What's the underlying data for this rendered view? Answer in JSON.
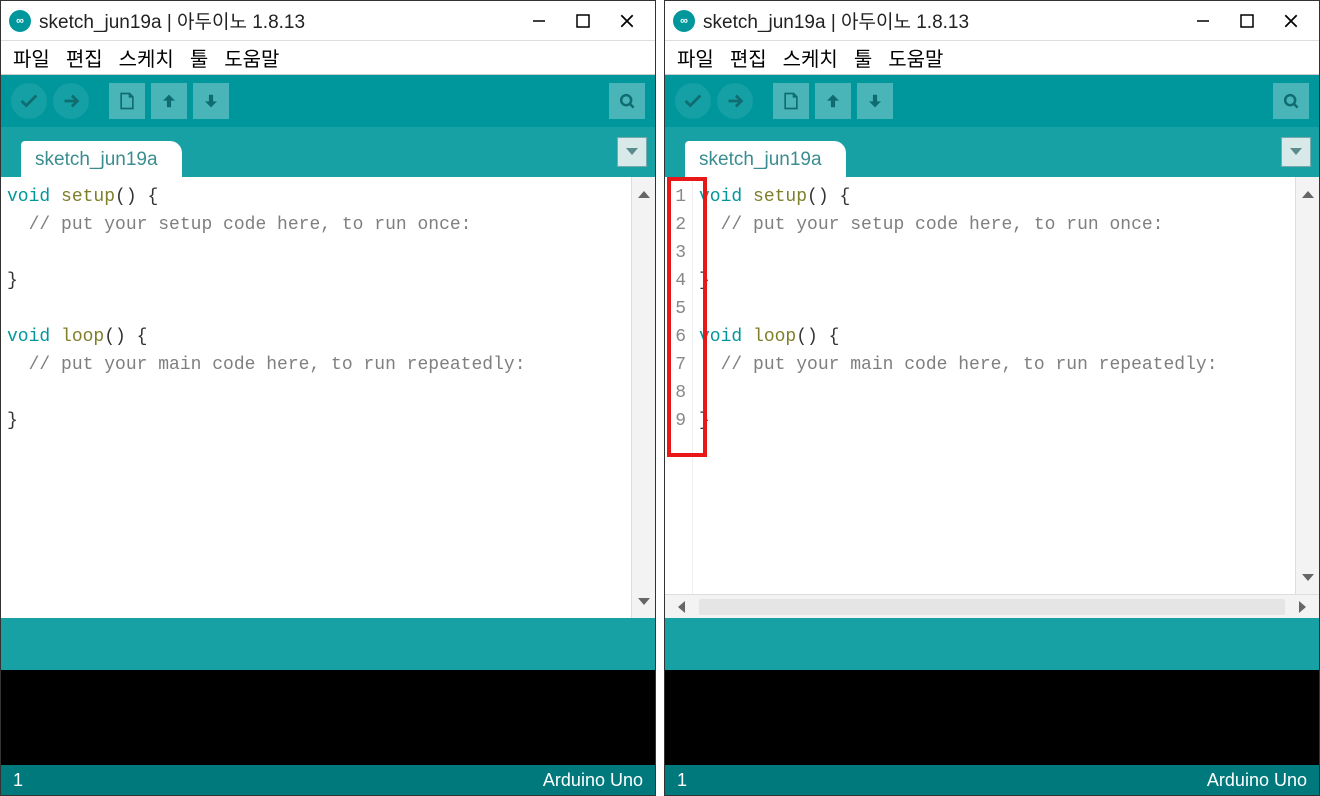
{
  "window": {
    "title": "sketch_jun19a | 아두이노 1.8.13",
    "iconGlyph": "∞"
  },
  "menu": {
    "file": "파일",
    "edit": "편집",
    "sketch": "스케치",
    "tools": "툴",
    "help": "도움말"
  },
  "tab": {
    "name": "sketch_jun19a"
  },
  "code": {
    "lines": [
      {
        "tokens": [
          {
            "t": "kw",
            "s": "void"
          },
          {
            "t": "p",
            "s": " "
          },
          {
            "t": "fn",
            "s": "setup"
          },
          {
            "t": "p",
            "s": "() {"
          }
        ]
      },
      {
        "tokens": [
          {
            "t": "p",
            "s": "  "
          },
          {
            "t": "cm",
            "s": "// put your setup code here, to run once:"
          }
        ]
      },
      {
        "tokens": [
          {
            "t": "p",
            "s": ""
          }
        ]
      },
      {
        "tokens": [
          {
            "t": "p",
            "s": "}"
          }
        ]
      },
      {
        "tokens": [
          {
            "t": "p",
            "s": ""
          }
        ]
      },
      {
        "tokens": [
          {
            "t": "kw",
            "s": "void"
          },
          {
            "t": "p",
            "s": " "
          },
          {
            "t": "fn",
            "s": "loop"
          },
          {
            "t": "p",
            "s": "() {"
          }
        ]
      },
      {
        "tokens": [
          {
            "t": "p",
            "s": "  "
          },
          {
            "t": "cm",
            "s": "// put your main code here, to run repeatedly:"
          }
        ]
      },
      {
        "tokens": [
          {
            "t": "p",
            "s": ""
          }
        ]
      },
      {
        "tokens": [
          {
            "t": "p",
            "s": "}"
          }
        ]
      }
    ],
    "lineNumbers": [
      "1",
      "2",
      "3",
      "4",
      "5",
      "6",
      "7",
      "8",
      "9"
    ]
  },
  "status": {
    "line": "1",
    "board": "Arduino Uno"
  },
  "leftPane": {
    "showLineNumbers": false,
    "showHScroll": false,
    "highlightGutter": false
  },
  "rightPane": {
    "showLineNumbers": true,
    "showHScroll": true,
    "highlightGutter": true
  }
}
